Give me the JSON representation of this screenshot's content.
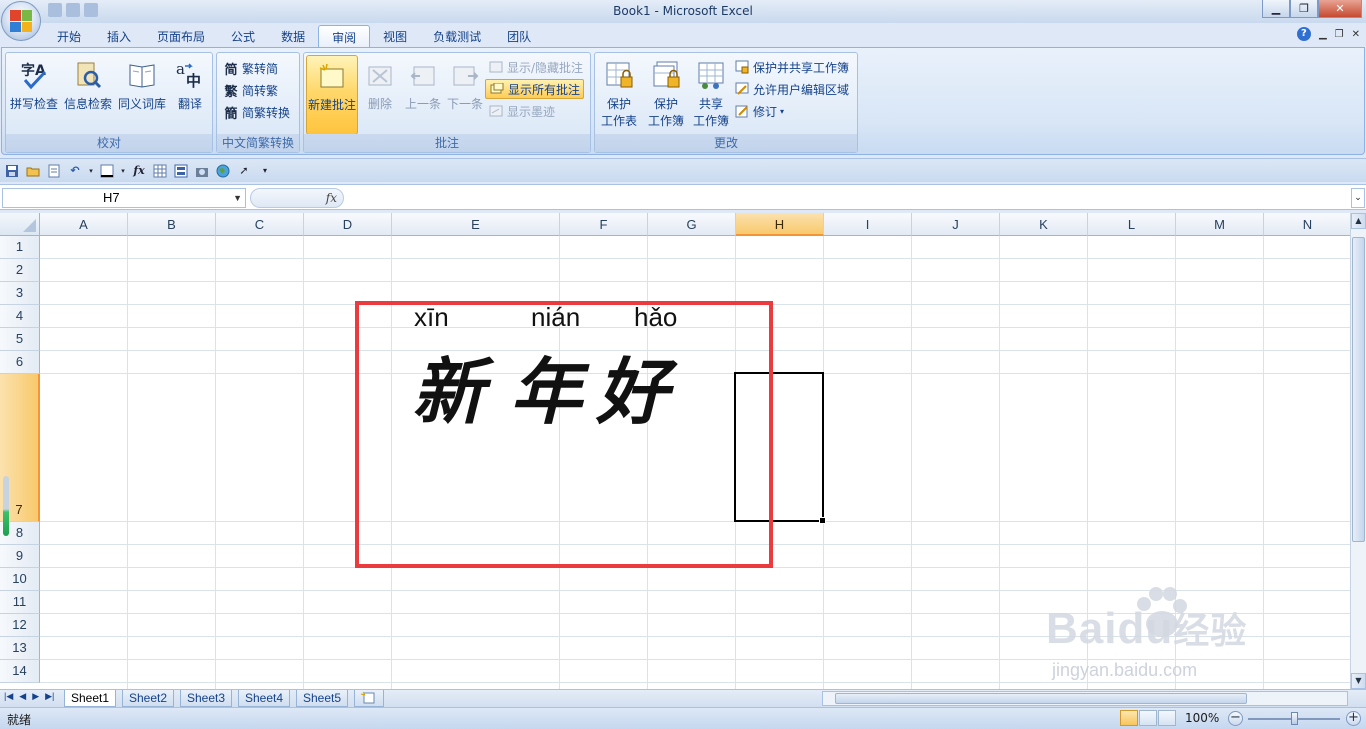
{
  "window": {
    "title": "Book1 - Microsoft Excel"
  },
  "tabs": [
    "开始",
    "插入",
    "页面布局",
    "公式",
    "数据",
    "审阅",
    "视图",
    "负载测试",
    "团队"
  ],
  "active_tab": "审阅",
  "ribbon": {
    "proofing": {
      "label": "校对",
      "spelling": "拼写检查",
      "research": "信息检索",
      "thesaurus": "同义词库",
      "translate": "翻译"
    },
    "chinese_conversion": {
      "label": "中文简繁转换",
      "to_simplified": "繁转简",
      "to_traditional": "简转繁",
      "convert": "简繁转换"
    },
    "comments": {
      "label": "批注",
      "new": "新建批注",
      "delete": "删除",
      "previous": "上一条",
      "next": "下一条",
      "show_hide": "显示/隐藏批注",
      "show_all": "显示所有批注",
      "show_ink": "显示墨迹"
    },
    "changes": {
      "label": "更改",
      "protect_sheet_line1": "保护",
      "protect_sheet_line2": "工作表",
      "protect_workbook_line1": "保护",
      "protect_workbook_line2": "工作簿",
      "share_workbook_line1": "共享",
      "share_workbook_line2": "工作簿",
      "protect_share": "保护并共享工作簿",
      "allow_edit_ranges": "允许用户编辑区域",
      "track_changes": "修订"
    }
  },
  "formula_bar": {
    "name_box": "H7",
    "fx": "fx",
    "value": ""
  },
  "columns": [
    "A",
    "B",
    "C",
    "D",
    "E",
    "F",
    "G",
    "H",
    "I",
    "J",
    "K",
    "L",
    "M",
    "N"
  ],
  "rows": [
    "1",
    "2",
    "3",
    "4",
    "5",
    "6",
    "7",
    "8",
    "9",
    "10",
    "11",
    "12",
    "13",
    "14"
  ],
  "selected_cell": {
    "column": "H",
    "row": "7"
  },
  "image": {
    "pinyin": [
      "xīn",
      "nián",
      "hǎo"
    ],
    "hanzi": [
      "新",
      "年",
      "好"
    ]
  },
  "sheets": [
    "Sheet1",
    "Sheet2",
    "Sheet3",
    "Sheet4",
    "Sheet5"
  ],
  "active_sheet": "Sheet1",
  "status": {
    "text": "就绪",
    "zoom": "100%"
  },
  "watermark": {
    "logo": "Baidu",
    "logo_cn": "经验",
    "url": "jingyan.baidu.com"
  },
  "colors": {
    "accent": "#15428b",
    "selection_header": "#f9c96c",
    "image_border": "#ec3b3e"
  }
}
